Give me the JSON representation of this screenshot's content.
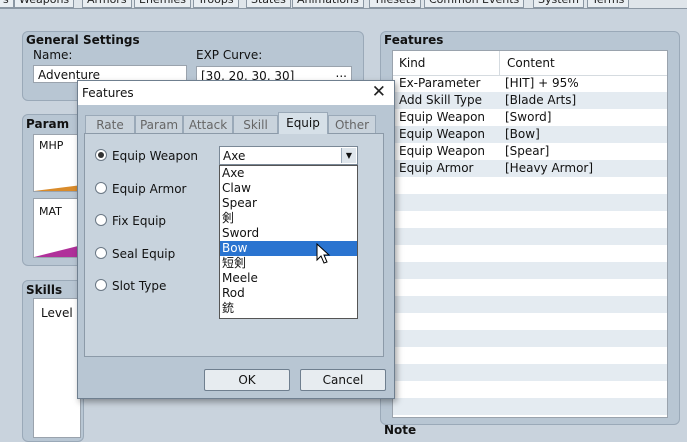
{
  "top_tabs": [
    "s",
    "Weapons",
    "Armors",
    "Enemies",
    "Troops",
    "States",
    "Animations",
    "Tilesets",
    "Common Events",
    "System",
    "Terms"
  ],
  "general": {
    "title": "General Settings",
    "name_label": "Name:",
    "name_value": "Adventure",
    "exp_label": "EXP Curve:",
    "exp_value": "[30, 20, 30, 30]",
    "exp_button": "..."
  },
  "params": {
    "title": "Param",
    "mhp": "MHP",
    "mat": "MAT"
  },
  "skills": {
    "title": "Skills",
    "level_header": "Level"
  },
  "features_panel": {
    "title": "Features",
    "col_kind": "Kind",
    "col_content": "Content",
    "rows": [
      {
        "kind": "Ex-Parameter",
        "content": "[HIT] + 95%"
      },
      {
        "kind": "Add Skill Type",
        "content": "[Blade Arts]"
      },
      {
        "kind": "Equip Weapon",
        "content": "[Sword]"
      },
      {
        "kind": "Equip Weapon",
        "content": "[Bow]"
      },
      {
        "kind": "Equip Weapon",
        "content": "[Spear]"
      },
      {
        "kind": "Equip Armor",
        "content": "[Heavy Armor]"
      }
    ]
  },
  "note": {
    "title": "Note"
  },
  "dialog": {
    "title": "Features",
    "close": "✕",
    "tabs": [
      "Rate",
      "Param",
      "Attack",
      "Skill",
      "Equip",
      "Other"
    ],
    "active_tab": "Equip",
    "radios": [
      {
        "label": "Equip Weapon",
        "checked": true
      },
      {
        "label": "Equip Armor",
        "checked": false
      },
      {
        "label": "Fix Equip",
        "checked": false
      },
      {
        "label": "Seal Equip",
        "checked": false
      },
      {
        "label": "Slot Type",
        "checked": false
      }
    ],
    "combo_value": "Axe",
    "dropdown_options": [
      "Axe",
      "Claw",
      "Spear",
      "剣",
      "Sword",
      "Bow",
      "短剣",
      "Meele",
      "Rod",
      "銃"
    ],
    "selected_option": "Bow",
    "ok": "OK",
    "cancel": "Cancel"
  },
  "colors": {
    "panel": "#b8c6d3",
    "selection": "#2a74d0",
    "graph_mhp": "#d98b2b",
    "graph_mat": "#b0309a"
  }
}
